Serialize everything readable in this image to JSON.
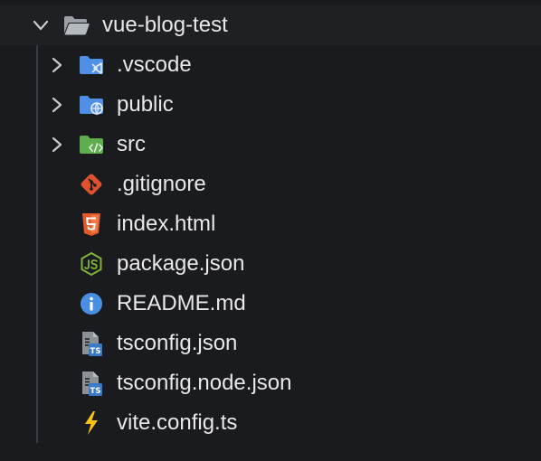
{
  "explorer": {
    "root": {
      "label": "vue-blog-test",
      "expanded": true,
      "icon": "folder-open-icon"
    },
    "folders": [
      {
        "label": ".vscode",
        "icon": "vscode-folder-icon",
        "expanded": false
      },
      {
        "label": "public",
        "icon": "public-folder-icon",
        "expanded": false
      },
      {
        "label": "src",
        "icon": "src-folder-icon",
        "expanded": false
      }
    ],
    "files": [
      {
        "label": ".gitignore",
        "icon": "git-icon"
      },
      {
        "label": "index.html",
        "icon": "html5-icon"
      },
      {
        "label": "package.json",
        "icon": "nodejs-icon"
      },
      {
        "label": "README.md",
        "icon": "info-icon"
      },
      {
        "label": "tsconfig.json",
        "icon": "typescript-config-icon"
      },
      {
        "label": "tsconfig.node.json",
        "icon": "typescript-config-icon"
      },
      {
        "label": "vite.config.ts",
        "icon": "vite-icon"
      }
    ]
  },
  "colors": {
    "background": "#1a1b1e",
    "text": "#e8e8ea",
    "folder_grey": "#9aa0a6",
    "folder_blue": "#4f8fe6",
    "folder_green": "#5fae4e",
    "git_orange": "#e0522d",
    "html_orange": "#e15a2a",
    "node_green": "#7fb33a",
    "info_blue": "#4a90e2",
    "ts_blue": "#3a78c8",
    "vite_yellow": "#f8c21a"
  }
}
